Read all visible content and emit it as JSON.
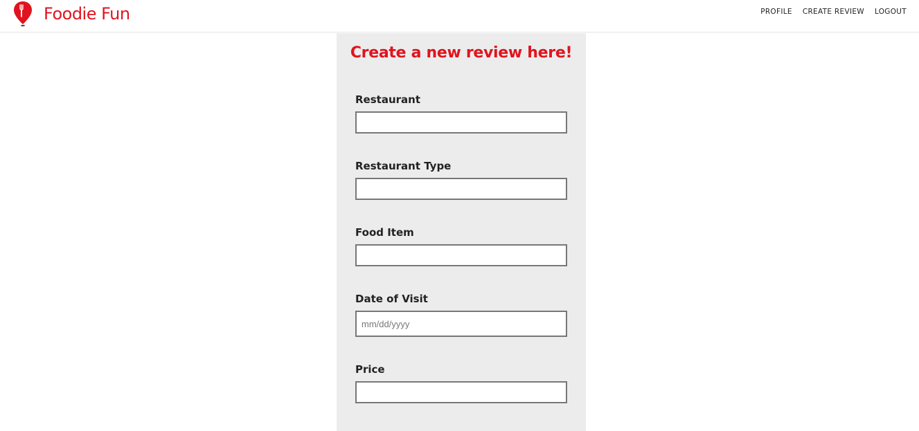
{
  "brand": {
    "name": "Foodie Fun",
    "color": "#e0141e"
  },
  "nav": {
    "profile": "PROFILE",
    "create_review": "CREATE REVIEW",
    "logout": "LOGOUT"
  },
  "form": {
    "title": "Create a new review here!",
    "fields": [
      {
        "label": "Restaurant",
        "value": "",
        "placeholder": ""
      },
      {
        "label": "Restaurant Type",
        "value": "",
        "placeholder": ""
      },
      {
        "label": "Food Item",
        "value": "",
        "placeholder": ""
      },
      {
        "label": "Date of Visit",
        "value": "",
        "placeholder": "mm/dd/yyyy"
      },
      {
        "label": "Price",
        "value": "",
        "placeholder": ""
      }
    ]
  },
  "icons": {
    "logo": "map-pin-fork-icon"
  },
  "colors": {
    "accent": "#e0141e",
    "panel_background": "#ececec",
    "input_border": "#777777"
  }
}
